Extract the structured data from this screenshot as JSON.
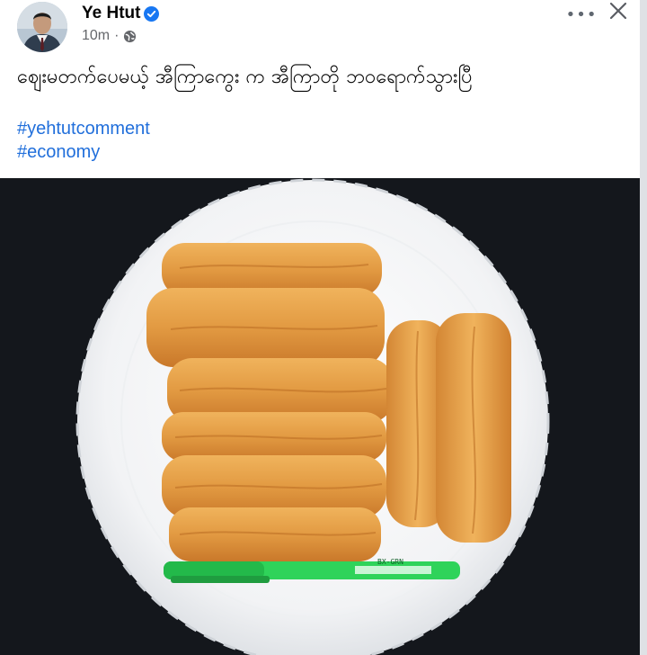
{
  "post": {
    "author": "Ye Htut",
    "time": "10m",
    "separator": "·",
    "text": "ဈေးမတက်ပေမယ့် အီကြာကွေး က အီကြာတို ဘဝရောက်သွားပြီ",
    "hashtags": [
      "#yehtutcomment",
      "#economy"
    ]
  },
  "icons": {
    "verified": "verified-badge-icon",
    "audience": "globe-icon",
    "more": "more-horizontal-icon",
    "close": "close-icon"
  },
  "ui": {
    "more_label": "•••"
  },
  "photo": {
    "pen_label": "BX-GRN"
  },
  "colors": {
    "link": "#216fdb",
    "verified": "#1877f2",
    "text": "#050505",
    "secondary": "#65676b"
  }
}
